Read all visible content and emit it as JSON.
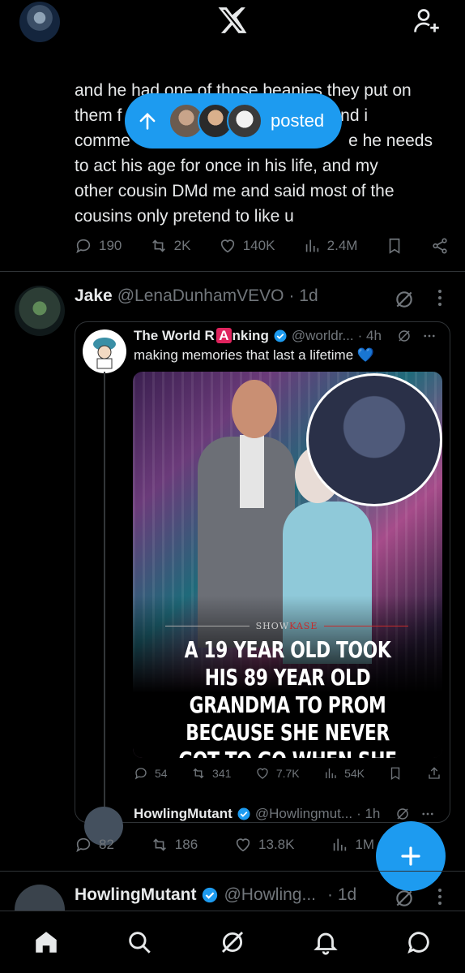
{
  "header": {
    "profile_icon": "avatar",
    "logo": "x-logo-icon",
    "add_user": "add-user-icon"
  },
  "posted_pill": {
    "label": "posted"
  },
  "tweet1": {
    "line0": "",
    "lines": [
      "and he had one of those beanies they put on",
      "them f",
      "comme",
      "to act his age for once in his life, and my",
      "other cousin DMd me and said most of the",
      "cousins only pretend to like u"
    ],
    "line1_right": "nd i",
    "line2_right": "e he needs",
    "actions": {
      "replies": "190",
      "reposts": "2K",
      "likes": "140K",
      "views": "2.4M"
    }
  },
  "tweet2": {
    "name": "Jake",
    "handle": "@LenaDunhamVEVO",
    "time": "· 1d",
    "quote": {
      "name": "The World R ",
      "name_badge": "A",
      "name_suffix": "nking",
      "handle": "@worldr...",
      "time": "· 4h",
      "text": "making memories that last a lifetime 💙",
      "media_brand_prefix": "SHOW",
      "media_brand_suffix": "KASE",
      "media_headline": "A 19 YEAR OLD TOOK HIS 89 YEAR OLD GRANDMA TO PROM BECAUSE SHE NEVER GOT TO GO WHEN SHE WAS YOUNGER",
      "actions": {
        "replies": "54",
        "reposts": "341",
        "likes": "7.7K",
        "views": "54K"
      }
    },
    "reply_preview": {
      "name": "HowlingMutant",
      "handle": "@Howlingmut...",
      "time": "· 1h"
    },
    "actions": {
      "replies": "82",
      "reposts": "186",
      "likes": "13.8K",
      "views": "1M"
    }
  },
  "tweet3": {
    "name": "HowlingMutant",
    "handle": "@Howling...",
    "time": "· 1d"
  },
  "colors": {
    "accent": "#1d9bf0",
    "muted": "#71767b",
    "background": "#000000"
  }
}
